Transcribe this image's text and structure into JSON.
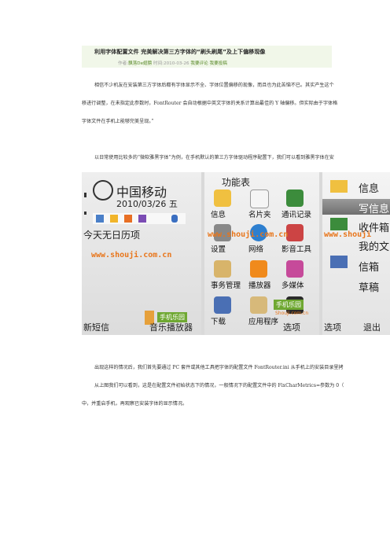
{
  "article": {
    "title": "利用字体配置文件 完美解决第三方字体的“刷头刷尾”及上下偏移现像",
    "meta_prefix": "作者:",
    "author": "飘落De翅膀",
    "time_prefix": "时间:",
    "date": "2010-03-26",
    "comment_link": "我要评论",
    "submit_link": "我要投稿",
    "para1": [
      "相信不少机友在安装第三方字体后都有字体显示不全、字体位置偏移的现像，而且也为此苦恼不已。其实产生这个",
      "移进行调整，在未指定此参数时，FontRouter 会自动根据中英文字体的关系计算出最佳的 Y 轴偏移。但实际由于字体格",
      "字体文件在手机上能够完美呈现。”"
    ],
    "para2": "以日常使用比较多的“微软雅黑字体”为例，在手机默认的第三方字体驱动程序配置下，我们可以看到雅黑字体在安",
    "para3": [
      "出现这样的情况后，我们首先要通过 PC 套件或其他工具把字体的配置文件 FontRouter.ini 从手机上的安装目录里拷",
      "从上图我们可以看到，这是在配置文件初始状态下的情况，一般情况下的配置文件中的 FixCharMetrics=参数为 0（",
      "中，并重启手机，再观察已安装字体的显示情况。"
    ]
  },
  "screens": {
    "s1": {
      "operator": "中国移动",
      "date": "2010/03/26 五",
      "agenda": "今天无日历项",
      "softkey_left": "新短信",
      "softkey_mid": "音乐播放器",
      "badge": "手机乐园"
    },
    "s2": {
      "header": "功能表",
      "items": [
        "信息",
        "名片夹",
        "通讯记录",
        "设置",
        "网络",
        "影音工具",
        "事务管理",
        "播放器",
        "多媒体",
        "下载",
        "应用程序"
      ],
      "softkey_right": "选项",
      "badge": "手机乐园",
      "sub_watermark": "Shouji.com.cn"
    },
    "s3": {
      "header": "信息",
      "items": [
        "写信息",
        "收件箱",
        "我的文",
        "信箱",
        "草稿"
      ],
      "softkey_left": "选项",
      "softkey_mid": "退出"
    },
    "watermark": "www.shouji.com.cn",
    "watermark_short": "www.shouji"
  }
}
